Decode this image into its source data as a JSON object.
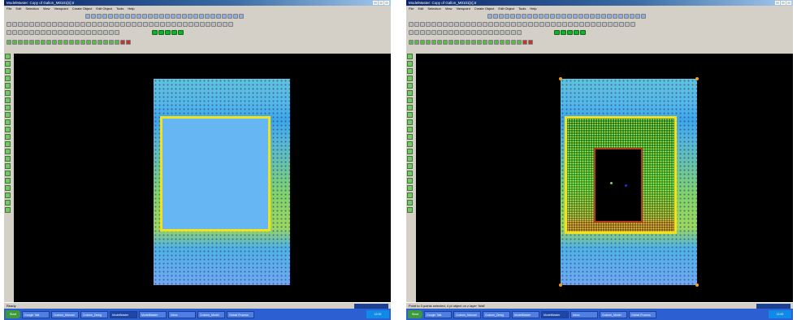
{
  "screens": [
    {
      "id": "left",
      "title": "ModelMaster: Copy of Gallon_M0101[n].tr",
      "menu": [
        "File",
        "Edit",
        "Selection",
        "View",
        "Viewpoint",
        "Create Object",
        "Edit Object",
        "Tools",
        "Help"
      ],
      "status_text": "Ready",
      "view_state": "opening-filled",
      "taskbar": {
        "start_label": "Start",
        "tasks": [
          "Google Talk",
          "Custom_Manual",
          "Custom_Desig",
          "ModelMaster",
          "ModelMaster",
          "Inbox",
          "Custom_Model",
          "Global Process"
        ],
        "clock": "12:00"
      }
    },
    {
      "id": "right",
      "title": "ModelMaster: Copy of Gallon_M0101[n].tr",
      "menu": [
        "File",
        "Edit",
        "Selection",
        "View",
        "Viewpoint",
        "Create Object",
        "Edit Object",
        "Tools",
        "Help"
      ],
      "status_text": "Point to 3 points selected, 4 pt object on z layer 'Wall'",
      "view_state": "opening-cut",
      "taskbar": {
        "start_label": "Start",
        "tasks": [
          "Google Talk",
          "Custom_Manual",
          "Custom_Desig",
          "ModelMaster",
          "ModelMaster",
          "Inbox",
          "Custom_Model",
          "Global Process"
        ],
        "clock": "12:00"
      }
    }
  ],
  "colors": {
    "viewport_bg": "#000000",
    "opening_outline": "#f2e11b",
    "filled_opening": "#66b6f4",
    "tunnel_walls": "#2c9b25",
    "inner_frame": "#b13a1f",
    "ui_chrome": "#d4d0c8",
    "taskbar": "#2c5fd1"
  },
  "icons": {
    "toolbar_rows": [
      "blue-navigation-icons",
      "gray-edit-icons",
      "green-layer-icons"
    ],
    "left_tool_column": "green-draw-tool-icons"
  }
}
